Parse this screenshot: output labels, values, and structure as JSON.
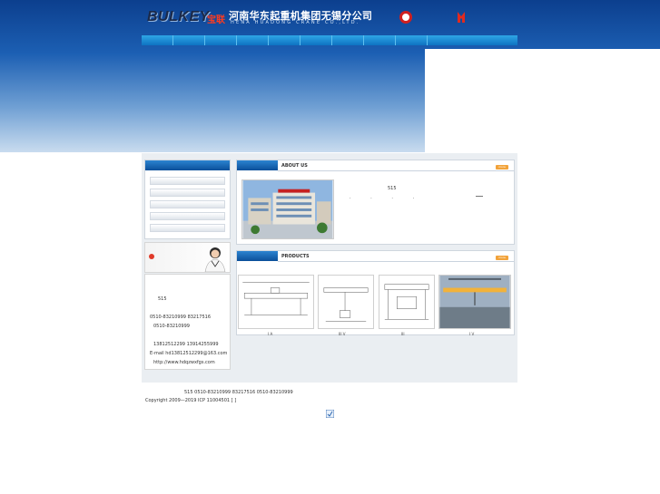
{
  "header": {
    "logo": "BULKEY",
    "logo_cn": "宝联",
    "company_cn": "河南华东起重机集团无锡分公司",
    "company_en": "HENA HUADONG CRANE CO.,LTD."
  },
  "about": {
    "title": "ABOUT US",
    "number": "515",
    "dots": ". . . ."
  },
  "products": {
    "title": "PRODUCTS",
    "items": [
      {
        "label": "I A"
      },
      {
        "label": "III V"
      },
      {
        "label": "III"
      },
      {
        "label": "I V"
      }
    ]
  },
  "contact": {
    "line1": "515",
    "line2": "0510-83210999 83217516",
    "line3": "0510-83210999",
    "line4": "13812512299 13914255999",
    "line5": "E-mail  hd13812512299@163.com",
    "line6": "http://www.hdqzwxfgs.com"
  },
  "footer": {
    "line1": "515      0510-83210999 83217516   0510-83210999",
    "line2": "Copyright 2009—2019    ICP 11004501          [   ]"
  },
  "colors": {
    "accent_blue": "#0a4f9a",
    "nav_blue": "#1a8ad6",
    "more_orange": "#f2a33a"
  }
}
